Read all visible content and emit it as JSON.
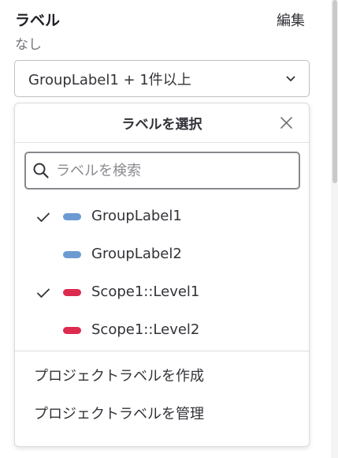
{
  "header": {
    "title": "ラベル",
    "edit_label": "編集",
    "value_text": "なし"
  },
  "select": {
    "value": "GroupLabel1 + 1件以上"
  },
  "dropdown": {
    "title": "ラベルを選択",
    "search": {
      "placeholder": "ラベルを検索",
      "value": ""
    },
    "labels": [
      {
        "name": "GroupLabel1",
        "checked": true,
        "color": "#6b9bd1"
      },
      {
        "name": "GroupLabel2",
        "checked": false,
        "color": "#6b9bd1"
      },
      {
        "name": "Scope1::Level1",
        "checked": true,
        "color": "#dd2b4f"
      },
      {
        "name": "Scope1::Level2",
        "checked": false,
        "color": "#dd2b4f"
      }
    ],
    "footer": {
      "create": "プロジェクトラベルを作成",
      "manage": "プロジェクトラベルを管理"
    }
  }
}
